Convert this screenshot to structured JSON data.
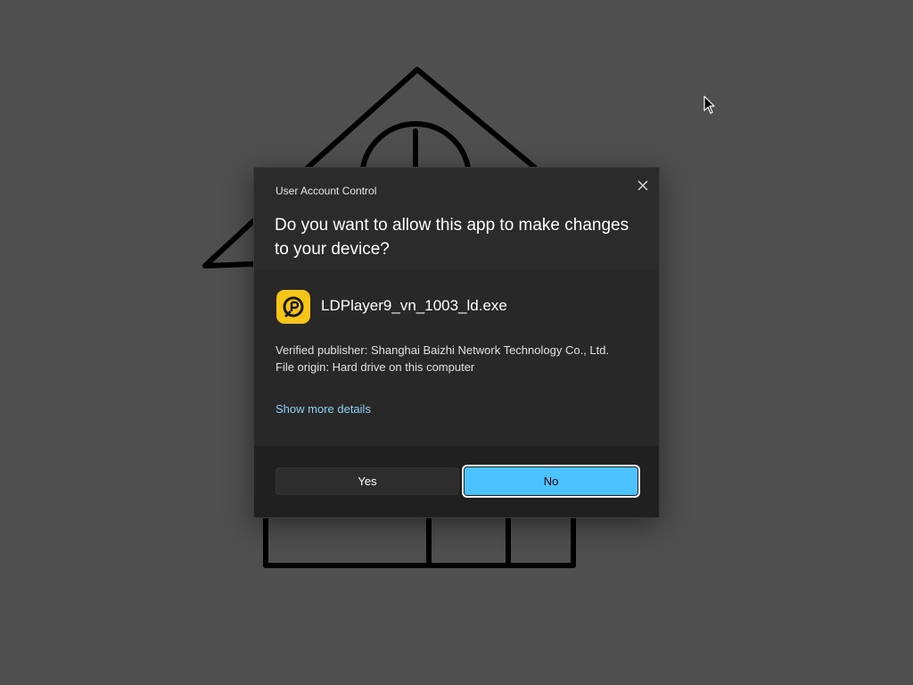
{
  "dialog": {
    "title": "User Account Control",
    "question": "Do you want to allow this app to make changes to your device?",
    "app_name": "LDPlayer9_vn_1003_ld.exe",
    "publisher": "Verified publisher: Shanghai Baizhi Network Technology Co., Ltd.",
    "origin": "File origin: Hard drive on this computer",
    "details_link": "Show more details",
    "yes_label": "Yes",
    "no_label": "No",
    "close_icon": "close-icon",
    "app_icon": "ldplayer-app-icon"
  },
  "colors": {
    "desktop_background": "#4f4f4f",
    "dialog_header": "#2b2b2b",
    "dialog_body": "#282828",
    "accent": "#4cc2ff",
    "link": "#8dd1f4",
    "app_icon": "#f5c518"
  }
}
